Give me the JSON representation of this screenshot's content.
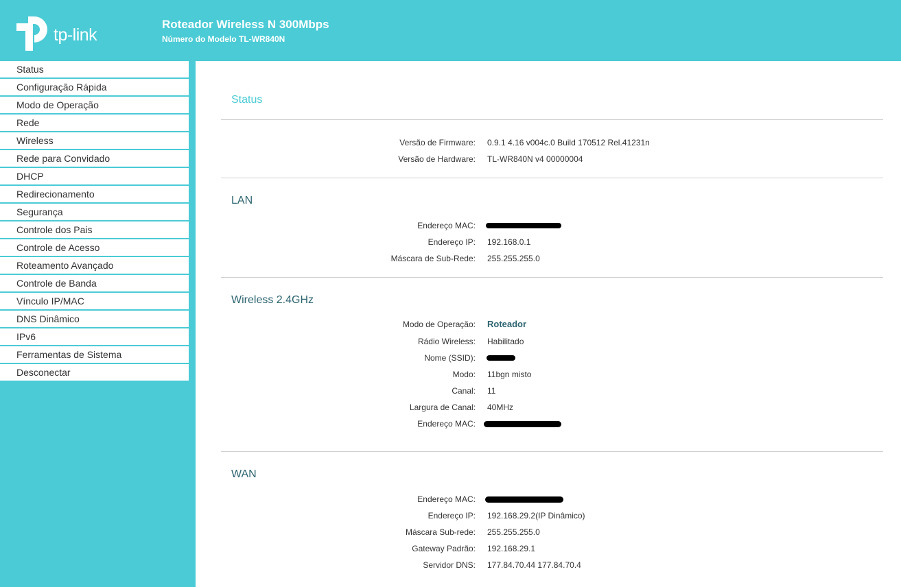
{
  "header": {
    "logo_text": "tp-link",
    "product_title": "Roteador Wireless N 300Mbps",
    "model_number": "Número do Modelo TL-WR840N"
  },
  "sidebar": {
    "items": [
      {
        "label": "Status"
      },
      {
        "label": "Configuração Rápida"
      },
      {
        "label": "Modo de Operação"
      },
      {
        "label": "Rede"
      },
      {
        "label": "Wireless"
      },
      {
        "label": "Rede para Convidado"
      },
      {
        "label": "DHCP"
      },
      {
        "label": "Redirecionamento"
      },
      {
        "label": "Segurança"
      },
      {
        "label": "Controle dos Pais"
      },
      {
        "label": "Controle de Acesso"
      },
      {
        "label": "Roteamento Avançado"
      },
      {
        "label": "Controle de Banda"
      },
      {
        "label": "Vínculo IP/MAC"
      },
      {
        "label": "DNS Dinâmico"
      },
      {
        "label": "IPv6"
      },
      {
        "label": "Ferramentas de Sistema"
      },
      {
        "label": "Desconectar"
      }
    ]
  },
  "status": {
    "title": "Status",
    "firmware_label": "Versão de Firmware:",
    "firmware_value": "0.9.1 4.16 v004c.0 Build 170512 Rel.41231n",
    "hardware_label": "Versão de Hardware:",
    "hardware_value": "TL-WR840N v4 00000004"
  },
  "lan": {
    "title": "LAN",
    "mac_label": "Endereço MAC:",
    "ip_label": "Endereço IP:",
    "ip_value": "192.168.0.1",
    "mask_label": "Máscara de Sub-Rede:",
    "mask_value": "255.255.255.0"
  },
  "wireless": {
    "title": "Wireless 2.4GHz",
    "mode_label": "Modo de Operação:",
    "mode_value": "Roteador",
    "radio_label": "Rádio Wireless:",
    "radio_value": "Habilitado",
    "ssid_label": "Nome (SSID):",
    "modo_label": "Modo:",
    "modo_value": "11bgn misto",
    "channel_label": "Canal:",
    "channel_value": "11",
    "width_label": "Largura de Canal:",
    "width_value": "40MHz",
    "mac_label": "Endereço MAC:"
  },
  "wan": {
    "title": "WAN",
    "mac_label": "Endereço MAC:",
    "ip_label": "Endereço IP:",
    "ip_value": "192.168.29.2(IP Dinâmico)",
    "mask_label": "Máscara Sub-rede:",
    "mask_value": "255.255.255.0",
    "gateway_label": "Gateway Padrão:",
    "gateway_value": "192.168.29.1",
    "dns_label": "Servidor DNS:",
    "dns_value": "177.84.70.44 177.84.70.4"
  },
  "colors": {
    "brand": "#4acbd6",
    "heading": "#2c6470"
  }
}
